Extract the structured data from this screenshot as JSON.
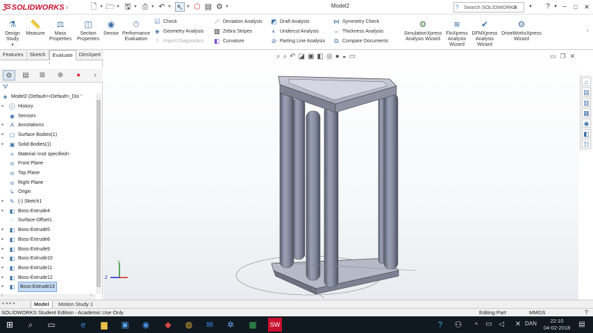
{
  "app": {
    "logo_text": "SOLIDWORKS",
    "doc_title": "Model2",
    "help_search_placeholder": "Search SOLIDWORKS Help",
    "help_icon": "?",
    "window_minimize": "–",
    "window_maximize": "□",
    "window_close": "✕"
  },
  "ribbon": {
    "design_study": "Design Study",
    "measure": "Measure",
    "mass_properties": "Mass Properties",
    "section_properties": "Section Properties",
    "sensor": "Sensor",
    "performance_evaluation": "Performance Evaluation",
    "check": "Check",
    "geometry_analysis": "Geometry Analysis",
    "import_diagnostics": "Import Diagnostics",
    "deviation_analysis": "Deviation Analysis",
    "zebra_stripes": "Zebra Stripes",
    "curvature": "Curvature",
    "draft_analysis": "Draft Analysis",
    "undercut_analysis": "Undercut Analysis",
    "parting_line_analysis": "Parting Line Analysis",
    "symmetry_check": "Symmetry Check",
    "thickness_analysis": "Thickness Analysis",
    "compare_documents": "Compare Documents",
    "simulationxpress": "SimulationXpress Analysis Wizard",
    "floxpress": "FloXpress Analysis Wizard",
    "dfmxpress": "DFMXpress Analysis Wizard",
    "driveworksxpress": "DriveWorksXpress Wizard"
  },
  "tabs": [
    "Features",
    "Sketch",
    "Evaluate",
    "DimXpert"
  ],
  "active_tab": "Evaluate",
  "tree": {
    "root": "Model2  (Default<<Default>_Dis",
    "items": [
      {
        "label": "History",
        "expandable": true
      },
      {
        "label": "Sensors",
        "expandable": false
      },
      {
        "label": "Annotations",
        "expandable": true
      },
      {
        "label": "Surface Bodies(1)",
        "expandable": true
      },
      {
        "label": "Solid Bodies(1)",
        "expandable": true
      },
      {
        "label": "Material <not specified>",
        "expandable": false
      },
      {
        "label": "Front Plane",
        "expandable": false
      },
      {
        "label": "Top Plane",
        "expandable": false
      },
      {
        "label": "Right Plane",
        "expandable": false
      },
      {
        "label": "Origin",
        "expandable": false
      },
      {
        "label": "(-) Sketch1",
        "expandable": true
      },
      {
        "label": "Boss-Extrude4",
        "expandable": true
      },
      {
        "label": "Surface-Offset1",
        "expandable": false
      },
      {
        "label": "Boss-Extrude5",
        "expandable": true
      },
      {
        "label": "Boss-Extrude8",
        "expandable": true
      },
      {
        "label": "Boss-Extrude9",
        "expandable": true
      },
      {
        "label": "Boss-Extrude10",
        "expandable": true
      },
      {
        "label": "Boss-Extrude11",
        "expandable": true
      },
      {
        "label": "Boss-Extrude12",
        "expandable": true
      },
      {
        "label": "Boss-Extrude13",
        "expandable": true,
        "selected": true
      }
    ]
  },
  "bottom_tabs": [
    "Model",
    "Motion Study 1"
  ],
  "status": {
    "left": "SOLIDWORKS Student Edition - Academic Use Only",
    "mode": "Editing Part",
    "units": "MMGS"
  },
  "taskbar": {
    "lang": "DAN",
    "time": "22:10",
    "date": "04-02-2018"
  },
  "triad": {
    "x": "X",
    "y": "Y",
    "z": "Z"
  }
}
